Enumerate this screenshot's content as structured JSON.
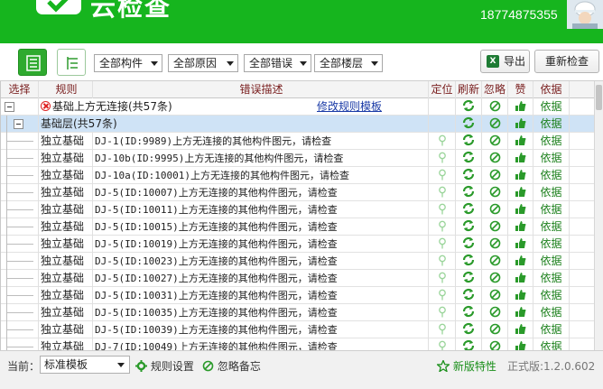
{
  "header": {
    "title": "云检查",
    "phone": "18774875355"
  },
  "toolbar": {
    "filters": [
      "全部构件",
      "全部原因",
      "全部错误",
      "全部楼层"
    ],
    "export_label": "导出",
    "recheck_label": "重新检查"
  },
  "columns": [
    "选择",
    "规则",
    "错误描述",
    "定位",
    "刷新",
    "忽略",
    "赞",
    "依据"
  ],
  "group": {
    "title": "基础上方无连接(共57条)",
    "edit_link": "修改规则模板",
    "subgroup": "基础层(共57条)"
  },
  "basis_label": "依据",
  "rows": [
    {
      "rule": "独立基础",
      "desc": "DJ-1(ID:9989)上方无连接的其他构件图元，请检查"
    },
    {
      "rule": "独立基础",
      "desc": "DJ-10b(ID:9995)上方无连接的其他构件图元，请检查"
    },
    {
      "rule": "独立基础",
      "desc": "DJ-10a(ID:10001)上方无连接的其他构件图元，请检查"
    },
    {
      "rule": "独立基础",
      "desc": "DJ-5(ID:10007)上方无连接的其他构件图元，请检查"
    },
    {
      "rule": "独立基础",
      "desc": "DJ-5(ID:10011)上方无连接的其他构件图元，请检查"
    },
    {
      "rule": "独立基础",
      "desc": "DJ-5(ID:10015)上方无连接的其他构件图元，请检查"
    },
    {
      "rule": "独立基础",
      "desc": "DJ-5(ID:10019)上方无连接的其他构件图元，请检查"
    },
    {
      "rule": "独立基础",
      "desc": "DJ-5(ID:10023)上方无连接的其他构件图元，请检查"
    },
    {
      "rule": "独立基础",
      "desc": "DJ-5(ID:10027)上方无连接的其他构件图元，请检查"
    },
    {
      "rule": "独立基础",
      "desc": "DJ-5(ID:10031)上方无连接的其他构件图元，请检查"
    },
    {
      "rule": "独立基础",
      "desc": "DJ-5(ID:10035)上方无连接的其他构件图元，请检查"
    },
    {
      "rule": "独立基础",
      "desc": "DJ-5(ID:10039)上方无连接的其他构件图元，请检查"
    },
    {
      "rule": "独立基础",
      "desc": "DJ-7(ID:10049)上方无连接的其他构件图元，请检查"
    }
  ],
  "status": {
    "current_label": "当前：",
    "template": "标准模板",
    "rule_settings": "规则设置",
    "ignore_notes": "忽略备忘",
    "new_features": "新版特性",
    "version": "正式版:1.2.0.602"
  },
  "colors": {
    "brand": "#16b51e",
    "accent_text": "#1a7f1a",
    "header_text": "#7a2020"
  }
}
